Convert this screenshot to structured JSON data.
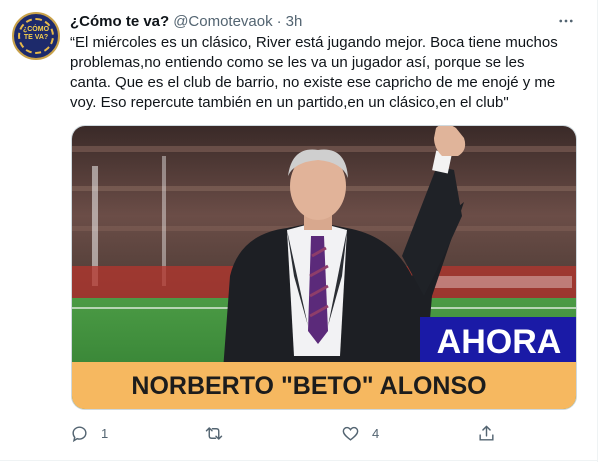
{
  "tweet": {
    "display_name": "¿Cómo te va?",
    "handle": "@Comotevaok",
    "separator": "·",
    "time": "3h",
    "text": "“El miércoles es un clásico, River está jugando mejor. Boca tiene muchos\nproblemas,no entiendo como se les va un jugador así, porque se les\ncanta. Que es el club de barrio, no existe ese capricho de me enojé y me\nvoy. Eso repercute también en un partido,en un clásico,en el club\"",
    "avatar": {
      "logo_text_line1": "¿CÓMO",
      "logo_text_line2": "TE VA?"
    }
  },
  "media": {
    "badge_text": "AHORA",
    "banner_text": "NORBERTO \"BETO\" ALONSO",
    "colors": {
      "badge_bg": "#1a1aa6",
      "banner_bg": "#f6b860",
      "field": "#3f8f3c",
      "suit": "#1d1f24",
      "tie": "#5b2a7a"
    }
  },
  "actions": {
    "reply": {
      "icon": "reply-icon",
      "count": "1"
    },
    "retweet": {
      "icon": "retweet-icon",
      "count": ""
    },
    "like": {
      "icon": "heart-icon",
      "count": "4"
    },
    "share": {
      "icon": "share-icon"
    }
  },
  "colors": {
    "text": "#0f1419",
    "secondary": "#536471",
    "border": "#eff3f4"
  }
}
